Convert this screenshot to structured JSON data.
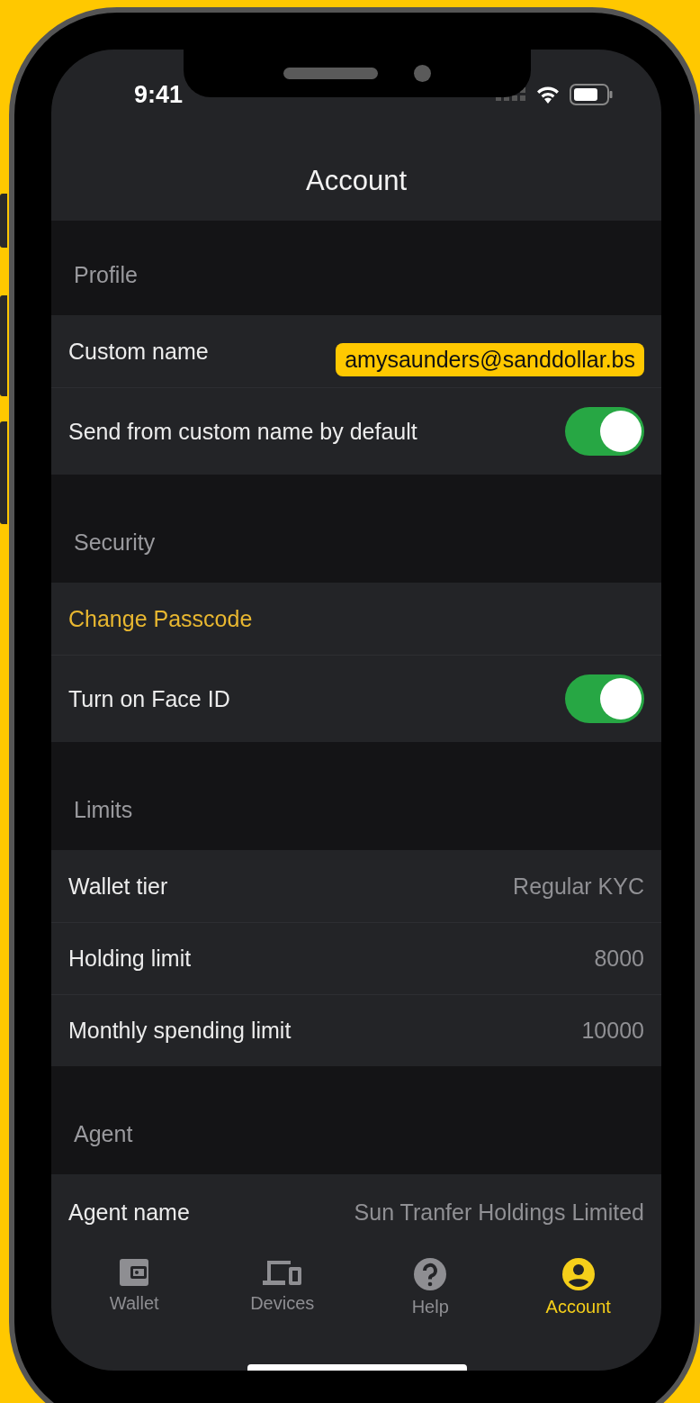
{
  "status_bar": {
    "time": "9:41"
  },
  "title": "Account",
  "sections": [
    {
      "header": "Profile",
      "rows": [
        {
          "kind": "value",
          "label": "Custom name",
          "value": "amysaunders@sanddollar.bs",
          "highlighted": true
        },
        {
          "kind": "toggle",
          "label": "Send from custom name by default",
          "on": true
        }
      ]
    },
    {
      "header": "Security",
      "rows": [
        {
          "kind": "link",
          "label": "Change Passcode"
        },
        {
          "kind": "toggle",
          "label": "Turn on Face ID",
          "on": true
        }
      ]
    },
    {
      "header": "Limits",
      "rows": [
        {
          "kind": "value",
          "label": "Wallet tier",
          "value": "Regular KYC",
          "highlighted": false
        },
        {
          "kind": "value",
          "label": "Holding limit",
          "value": "8000",
          "highlighted": false
        },
        {
          "kind": "value",
          "label": "Monthly spending limit",
          "value": "10000",
          "highlighted": false
        }
      ]
    },
    {
      "header": "Agent",
      "rows": [
        {
          "kind": "value",
          "label": "Agent name",
          "value": "Sun Tranfer Holdings Limited",
          "highlighted": false
        }
      ]
    }
  ],
  "tabs": [
    {
      "kind": "wallet",
      "label": "Wallet",
      "selected": false
    },
    {
      "kind": "devices",
      "label": "Devices",
      "selected": false
    },
    {
      "kind": "help",
      "label": "Help",
      "selected": false
    },
    {
      "kind": "account",
      "label": "Account",
      "selected": true
    }
  ]
}
